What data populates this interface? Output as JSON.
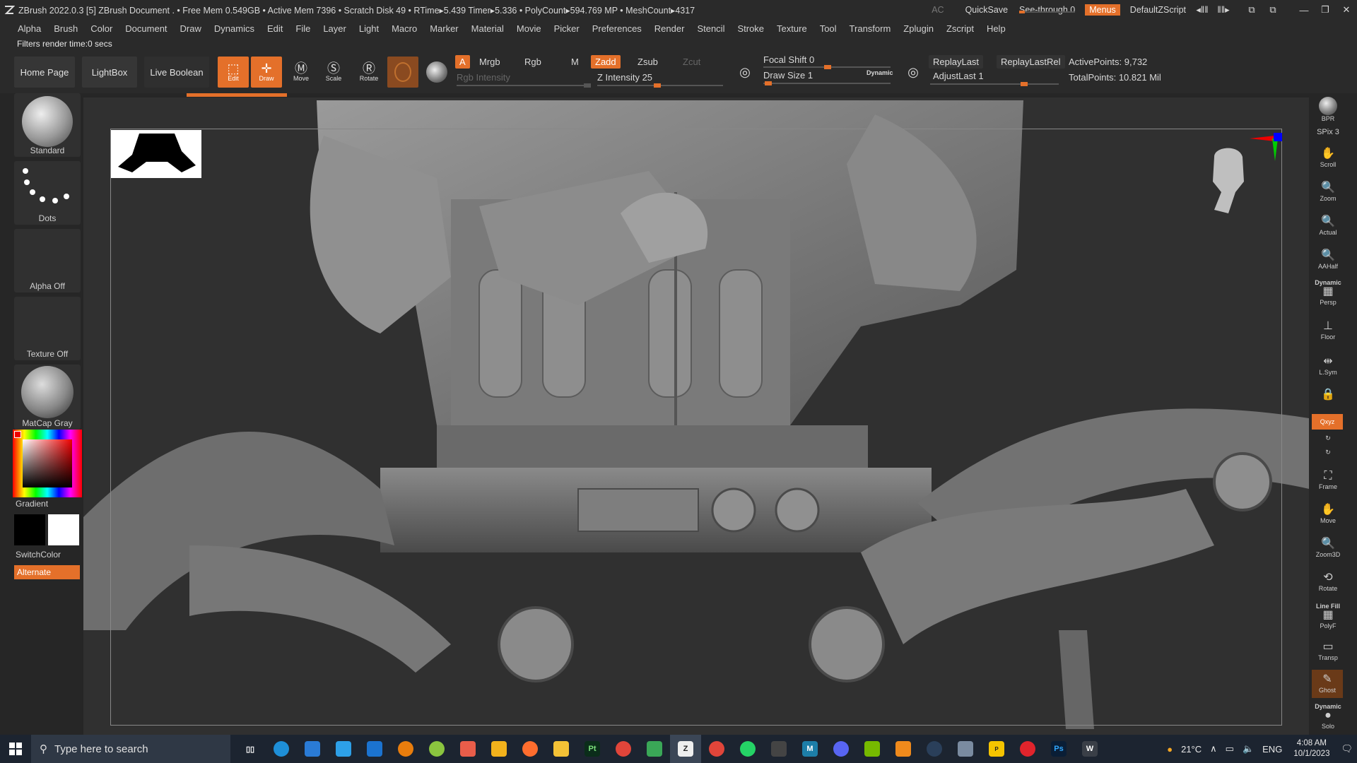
{
  "titlebar": {
    "app_title": "ZBrush 2022.0.3 [5]   ZBrush Document     . • Free Mem 0.549GB • Active Mem 7396 • Scratch Disk 49 •  RTime▸5.439 Timer▸5.336 • PolyCount▸594.769 MP  • MeshCount▸4317",
    "ac": "AC",
    "quicksave": "QuickSave",
    "seethrough": "See-through  0",
    "menus": "Menus",
    "script": "DefaultZScript"
  },
  "menubar": [
    "Alpha",
    "Brush",
    "Color",
    "Document",
    "Draw",
    "Dynamics",
    "Edit",
    "File",
    "Layer",
    "Light",
    "Macro",
    "Marker",
    "Material",
    "Movie",
    "Picker",
    "Preferences",
    "Render",
    "Stencil",
    "Stroke",
    "Texture",
    "Tool",
    "Transform",
    "Zplugin",
    "Zscript",
    "Help"
  ],
  "notice": "Filters render time:0 secs",
  "toolbar": {
    "home": "Home Page",
    "lightbox": "LightBox",
    "liveboolean": "Live Boolean",
    "edit": "Edit",
    "draw": "Draw",
    "move": "Move",
    "scale": "Scale",
    "rotate": "Rotate",
    "a": "A",
    "mrgb": "Mrgb",
    "rgb": "Rgb",
    "m": "M",
    "zadd": "Zadd",
    "zsub": "Zsub",
    "zcut": "Zcut",
    "rgb_intensity": "Rgb Intensity",
    "z_intensity": "Z Intensity 25",
    "focal_shift": "Focal Shift 0",
    "draw_size": "Draw Size 1",
    "dynamic": "Dynamic",
    "replaylast": "ReplayLast",
    "replaylastrel": "ReplayLastRel",
    "adjustlast": "AdjustLast 1",
    "activepoints": "ActivePoints: 9,732",
    "totalpoints": "TotalPoints: 10.821 Mil"
  },
  "leftshelf": {
    "standard": "Standard",
    "dots": "Dots",
    "alpha_off": "Alpha Off",
    "texture_off": "Texture Off",
    "matcap": "MatCap Gray",
    "gradient": "Gradient",
    "switchcolor": "SwitchColor",
    "alternate": "Alternate"
  },
  "rightshelf": [
    {
      "id": "bpr",
      "label": "BPR"
    },
    {
      "id": "spix",
      "label": "SPix 3"
    },
    {
      "id": "scroll",
      "label": "Scroll"
    },
    {
      "id": "zoom",
      "label": "Zoom"
    },
    {
      "id": "actual",
      "label": "Actual"
    },
    {
      "id": "aahalf",
      "label": "AAHalf"
    },
    {
      "id": "persp",
      "label": "Persp"
    },
    {
      "id": "persp_top",
      "label": "Dynamic"
    },
    {
      "id": "floor",
      "label": "Floor"
    },
    {
      "id": "lsym",
      "label": "L.Sym"
    },
    {
      "id": "xyz",
      "label": "Qxyz"
    },
    {
      "id": "frame",
      "label": "Frame"
    },
    {
      "id": "move",
      "label": "Move"
    },
    {
      "id": "zoom3d",
      "label": "Zoom3D"
    },
    {
      "id": "rotate",
      "label": "Rotate"
    },
    {
      "id": "polyf",
      "label": "PolyF"
    },
    {
      "id": "linefill",
      "label": "Line Fill"
    },
    {
      "id": "transp",
      "label": "Transp"
    },
    {
      "id": "ghost",
      "label": "Ghost"
    },
    {
      "id": "solo",
      "label": "Solo"
    },
    {
      "id": "solo_top",
      "label": "Dynamic"
    }
  ],
  "taskbar": {
    "search_placeholder": "Type here to search",
    "temp": "21°C",
    "lang": "ENG",
    "time": "4:08 AM",
    "date": "10/1/2023"
  },
  "colors": {
    "accent": "#e4702a",
    "bg_panel": "#2a2a2a",
    "viewport": "#303030"
  }
}
